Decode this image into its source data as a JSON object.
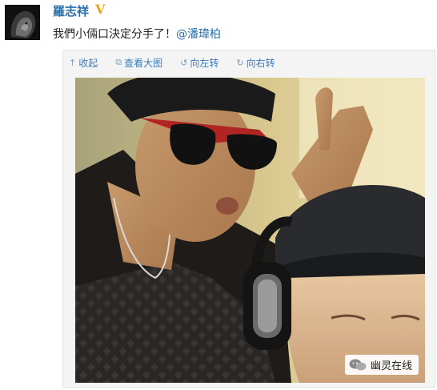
{
  "post": {
    "username": "羅志祥",
    "verified_badge": "V",
    "text": "我們小倆口決定分手了！",
    "mention": "@潘瑋柏"
  },
  "toolbar": {
    "items": [
      {
        "label": "收起",
        "icon": "arrow-up-icon"
      },
      {
        "label": "查看大图",
        "icon": "external-view-icon"
      },
      {
        "label": "向左转",
        "icon": "rotate-left-icon"
      },
      {
        "label": "向右转",
        "icon": "rotate-right-icon"
      }
    ]
  },
  "watermark": {
    "label": "幽灵在线",
    "icon": "wechat-icon"
  },
  "colors": {
    "link": "#2a6faa",
    "toolbar_link": "#3a7bbd",
    "badge": "#e8a317"
  }
}
